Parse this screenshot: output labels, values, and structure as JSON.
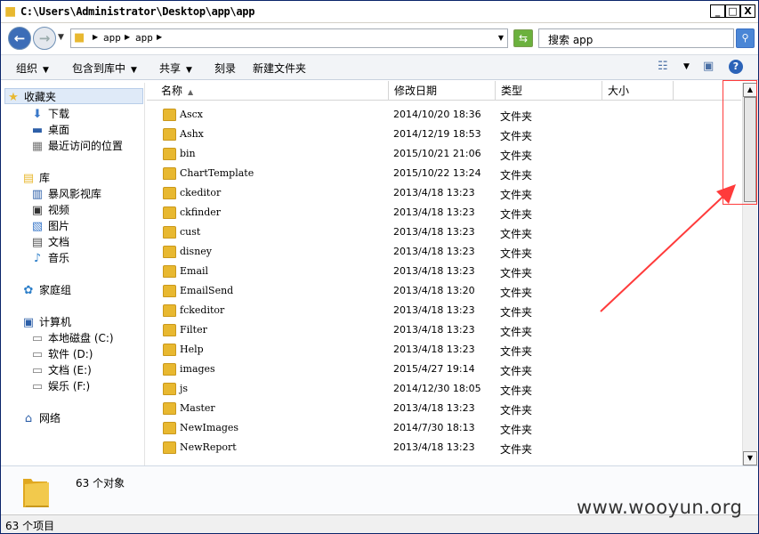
{
  "window": {
    "title": "C:\\Users\\Administrator\\Desktop\\app\\app",
    "minimize": "_",
    "maximize": "□",
    "close": "X"
  },
  "address": {
    "crumbs": [
      "app",
      "app"
    ],
    "search_placeholder": "搜索 app",
    "back_glyph": "←",
    "forward_glyph": "→",
    "search_glyph": "⚲",
    "refresh_glyph": "⇆"
  },
  "toolbar": {
    "organize": "组织",
    "include_in_library": "包含到库中",
    "share": "共享",
    "burn": "刻录",
    "new_folder": "新建文件夹",
    "help_glyph": "?"
  },
  "nav": {
    "favorites": "收藏夹",
    "downloads": "下载",
    "desktop": "桌面",
    "recent": "最近访问的位置",
    "libraries": "库",
    "storm_video": "暴风影视库",
    "videos": "视频",
    "pictures": "图片",
    "documents": "文档",
    "music": "音乐",
    "homegroup": "家庭组",
    "computer": "计算机",
    "drive_c": "本地磁盘 (C:)",
    "drive_d": "软件 (D:)",
    "drive_e": "文档 (E:)",
    "drive_f": "娱乐 (F:)",
    "network": "网络"
  },
  "columns": {
    "name": "名称",
    "date": "修改日期",
    "type": "类型",
    "size": "大小"
  },
  "files": [
    {
      "name": "Ascx",
      "date": "2014/10/20 18:36",
      "type": "文件夹"
    },
    {
      "name": "Ashx",
      "date": "2014/12/19 18:53",
      "type": "文件夹"
    },
    {
      "name": "bin",
      "date": "2015/10/21 21:06",
      "type": "文件夹"
    },
    {
      "name": "ChartTemplate",
      "date": "2015/10/22 13:24",
      "type": "文件夹"
    },
    {
      "name": "ckeditor",
      "date": "2013/4/18 13:23",
      "type": "文件夹"
    },
    {
      "name": "ckfinder",
      "date": "2013/4/18 13:23",
      "type": "文件夹"
    },
    {
      "name": "cust",
      "date": "2013/4/18 13:23",
      "type": "文件夹"
    },
    {
      "name": "disney",
      "date": "2013/4/18 13:23",
      "type": "文件夹"
    },
    {
      "name": "Email",
      "date": "2013/4/18 13:23",
      "type": "文件夹"
    },
    {
      "name": "EmailSend",
      "date": "2013/4/18 13:20",
      "type": "文件夹"
    },
    {
      "name": "fckeditor",
      "date": "2013/4/18 13:23",
      "type": "文件夹"
    },
    {
      "name": "Filter",
      "date": "2013/4/18 13:23",
      "type": "文件夹"
    },
    {
      "name": "Help",
      "date": "2013/4/18 13:23",
      "type": "文件夹"
    },
    {
      "name": "images",
      "date": "2015/4/27 19:14",
      "type": "文件夹"
    },
    {
      "name": "js",
      "date": "2014/12/30 18:05",
      "type": "文件夹"
    },
    {
      "name": "Master",
      "date": "2013/4/18 13:23",
      "type": "文件夹"
    },
    {
      "name": "NewImages",
      "date": "2014/7/30 18:13",
      "type": "文件夹"
    },
    {
      "name": "NewReport",
      "date": "2013/4/18 13:23",
      "type": "文件夹"
    }
  ],
  "details": {
    "object_count": "63 个对象"
  },
  "status": {
    "items": "63 个项目"
  },
  "watermark": "www.wooyun.org",
  "colors": {
    "annotation": "#ff3b3b",
    "folder": "#e8b830"
  }
}
